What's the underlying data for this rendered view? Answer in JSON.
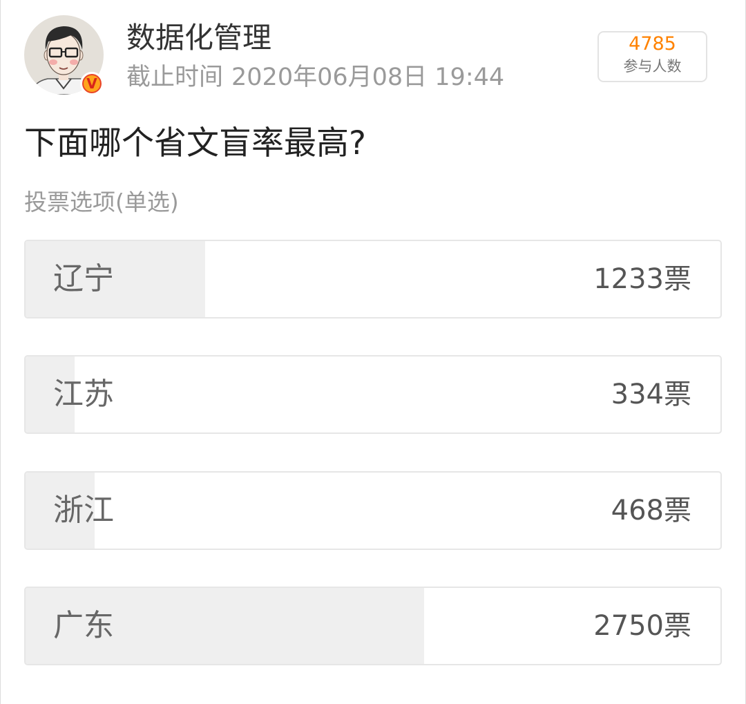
{
  "account": {
    "name": "数据化管理",
    "verified_badge": "V"
  },
  "deadline": {
    "label": "截止时间",
    "value": "2020年06月08日 19:44"
  },
  "participants": {
    "count": "4785",
    "label": "参与人数"
  },
  "poll": {
    "question": "下面哪个省文盲率最高?",
    "options_header": "投票选项(单选)"
  },
  "options": [
    {
      "label": "辽宁",
      "votes": "1233票",
      "fill": 0.258
    },
    {
      "label": "江苏",
      "votes": "334票",
      "fill": 0.071
    },
    {
      "label": "浙江",
      "votes": "468票",
      "fill": 0.099
    },
    {
      "label": "广东",
      "votes": "2750票",
      "fill": 0.574
    }
  ],
  "icons": {
    "avatar": "cartoon-portrait",
    "verified": "verified-badge-icon"
  },
  "colors": {
    "accent": "#ff8200",
    "vote_fill": "#efefef",
    "badge": "#ffa41b"
  }
}
